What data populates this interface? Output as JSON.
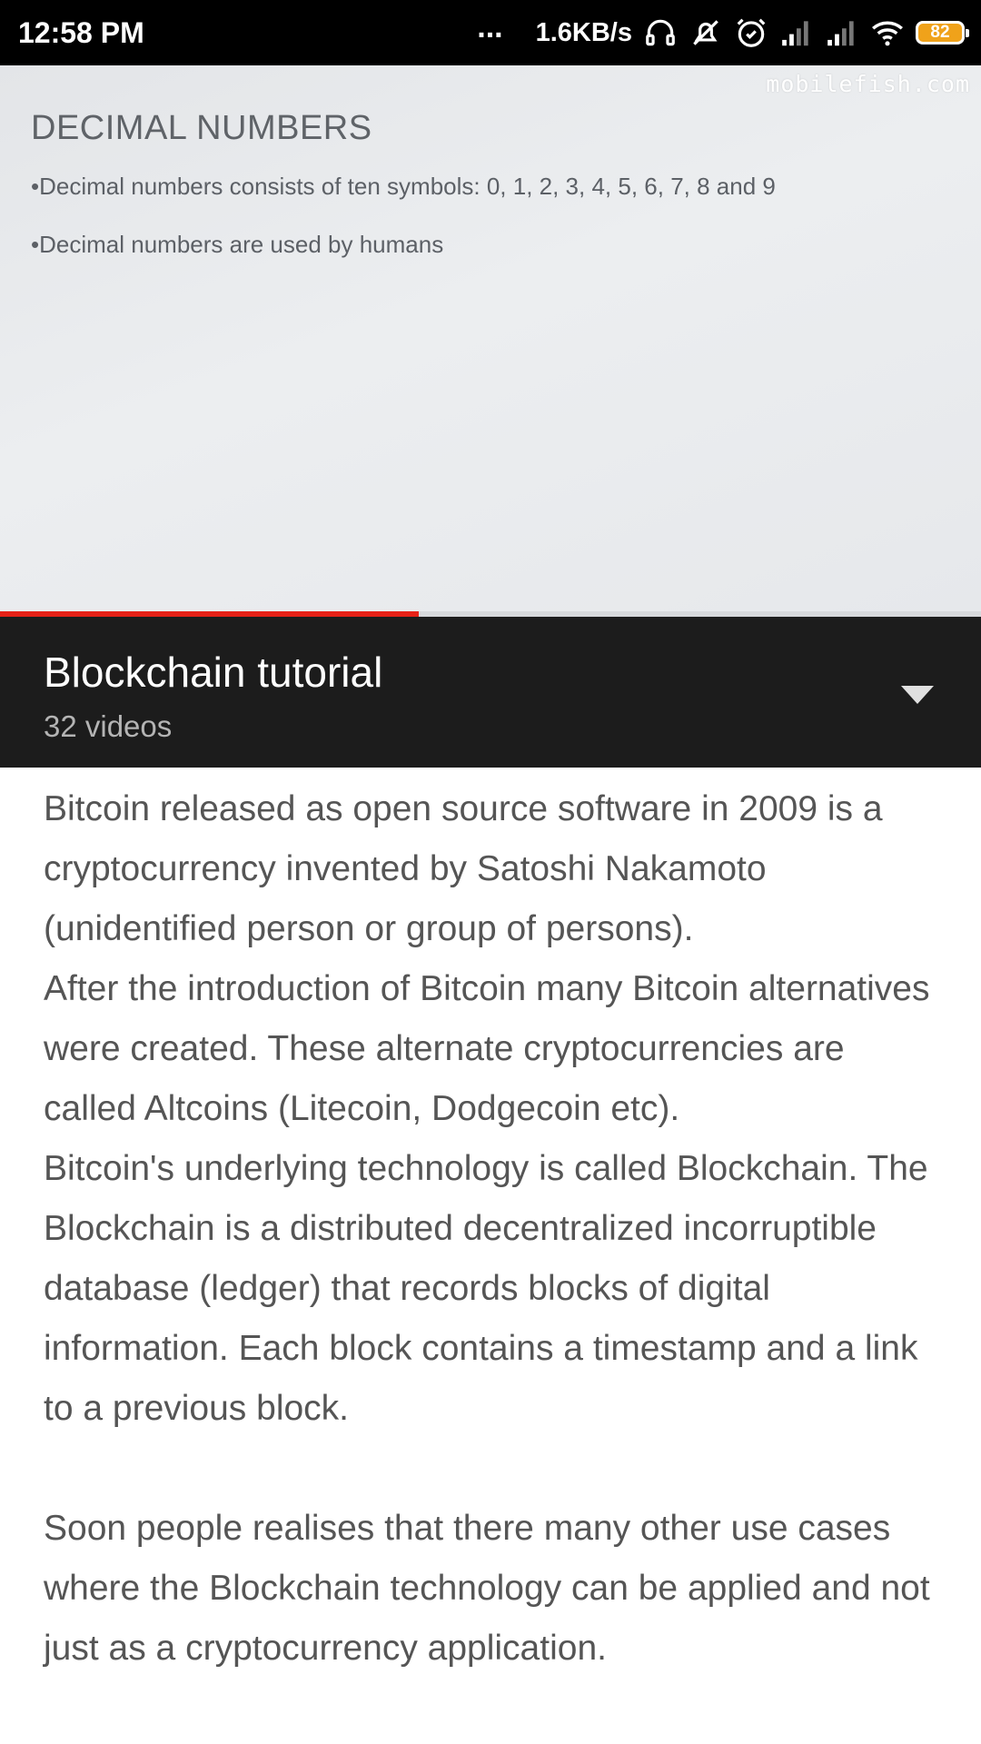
{
  "status_bar": {
    "time": "12:58 PM",
    "dots": "...",
    "network_speed": "1.6KB/s",
    "battery_level": "82",
    "icons": [
      "headset-icon",
      "mute-icon",
      "alarm-icon",
      "signal-icon",
      "signal-icon",
      "wifi-icon",
      "battery-icon"
    ]
  },
  "video": {
    "watermark": "mobilefish.com",
    "slide_title": "DECIMAL NUMBERS",
    "bullets": [
      "Decimal numbers consists of ten symbols: 0, 1, 2, 3, 4, 5, 6, 7, 8 and 9",
      "Decimal numbers are used by humans"
    ],
    "progress_fraction": 0.427,
    "progress_color": "#e62117"
  },
  "playlist": {
    "title": "Blockchain tutorial",
    "count": "32 videos",
    "expand_icon": "chevron-down-icon"
  },
  "description": {
    "paragraphs": [
      "Bitcoin released as open source software in 2009 is a cryptocurrency invented by Satoshi Nakamoto (unidentified person or group of persons).",
      "After the introduction of Bitcoin many Bitcoin alternatives were created. These alternate cryptocurrencies are called Altcoins (Litecoin, Dodgecoin etc).",
      "Bitcoin's underlying technology is called Blockchain. The Blockchain is a distributed decentralized incorruptible database (ledger) that records blocks of digital information. Each block contains a timestamp and a link to a previous block.",
      "Soon people realises that there many other use cases where the Blockchain technology can be applied and not just as a cryptocurrency application."
    ]
  }
}
